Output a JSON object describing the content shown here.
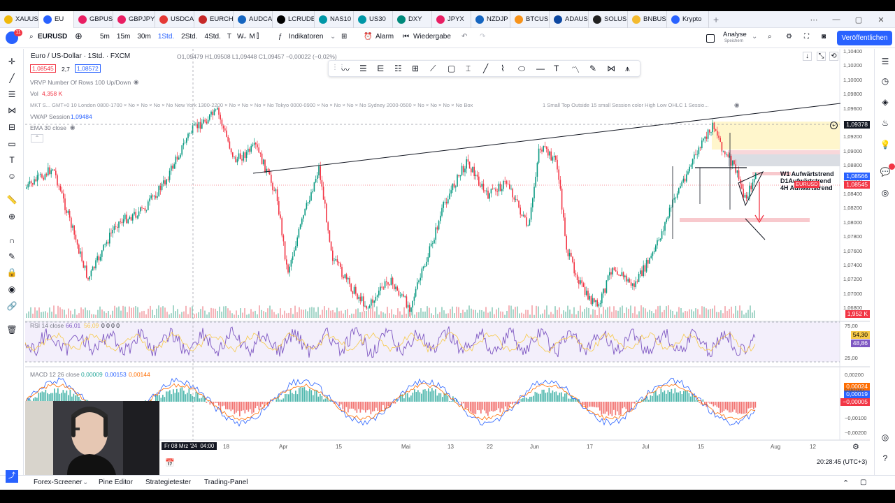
{
  "tabs": [
    {
      "label": "XAUUS",
      "color": "#f0b90b",
      "active": false
    },
    {
      "label": "EU",
      "color": "#2962ff",
      "active": true
    },
    {
      "label": "GBPUS",
      "color": "#e91e63",
      "active": false
    },
    {
      "label": "GBPJPY",
      "color": "#e91e63",
      "active": false
    },
    {
      "label": "USDCA",
      "color": "#e53935",
      "active": false
    },
    {
      "label": "EURCH",
      "color": "#c62828",
      "active": false
    },
    {
      "label": "AUDCA",
      "color": "#1565c0",
      "active": false
    },
    {
      "label": "LCRUDE",
      "color": "#000000",
      "active": false
    },
    {
      "label": "NAS10",
      "color": "#0097a7",
      "active": false
    },
    {
      "label": "US30",
      "color": "#0097a7",
      "active": false
    },
    {
      "label": "DXY",
      "color": "#00897b",
      "active": false
    },
    {
      "label": "JPYX",
      "color": "#e91e63",
      "active": false
    },
    {
      "label": "NZDJP",
      "color": "#1565c0",
      "active": false
    },
    {
      "label": "BTCUS",
      "color": "#f7931a",
      "active": false
    },
    {
      "label": "ADAUS",
      "color": "#0d47a1",
      "active": false
    },
    {
      "label": "SOLUS",
      "color": "#212121",
      "active": false
    },
    {
      "label": "BNBUS",
      "color": "#f3ba2f",
      "active": false
    },
    {
      "label": "Krypto",
      "color": "#2962ff",
      "active": false
    }
  ],
  "topbar": {
    "symbol": "EURUSD",
    "notif_count": "11",
    "timeframes": [
      "5m",
      "15m",
      "30m",
      "1Std.",
      "2Std.",
      "4Std.",
      "T",
      "W",
      "M"
    ],
    "active_timeframe": "1Std.",
    "indicators": "Indikatoren",
    "alarm": "Alarm",
    "replay": "Wiedergabe",
    "analyse": "Analyse",
    "analyse_sub": "Speichern",
    "publish": "Veröffentlichen"
  },
  "legend": {
    "title": "Euro / US-Dollar · 1Std. · FXCM",
    "ohlc": "O1,09479 H1,09508 L1,09448 C1,09457 −0,00022 (−0,02%)",
    "bid": "1,08545",
    "spread": "2,7",
    "ask": "1,08572",
    "vrvp": "VRVP Number Of Rows 100 Up/Down",
    "vol_label": "Vol",
    "vol_value": "4,358 K",
    "mkt": "MKT S... GMT+0 10 London 0800-1700 × No × No × No × No New York 1300-2200 × No × No × No × No Tokyo 0000-0900 × No × No × No × No Sydney 2000-0500 × No × No × No × No Box",
    "mkt2": "1 Small Top Outside 15 small Session color High Low OHLC 1 Sessio...",
    "vwap_label": "VWAP Session",
    "vwap_value": "1,09484",
    "ema": "EMA 30 close",
    "rsi": "RSI 14 close",
    "rsi_value": "66,01",
    "rsi_value2": "56,09",
    "rsi_zeros": "0 0 0 0",
    "macd": "MACD 12 26 close",
    "macd_v1": "0,00009",
    "macd_v2": "0,00153",
    "macd_v3": "0,00144"
  },
  "annotations": [
    "W1 Aufwärtstrend",
    "D1Aufwärtstrend",
    "4H Aufwärtstrend"
  ],
  "price_axis": [
    "1,10400",
    "1,10200",
    "1,10000",
    "1,09800",
    "1,09600",
    "1,09400",
    "1,09200",
    "1,09000",
    "1,08800",
    "1,08600",
    "1,08400",
    "1,08200",
    "1,08000",
    "1,07800",
    "1,07600",
    "1,07400",
    "1,07200",
    "1,07000",
    "1,06800"
  ],
  "price_tags": [
    {
      "text": "1,09378",
      "bg": "#131722"
    },
    {
      "text": "1,08566",
      "bg": "#2962ff"
    },
    {
      "text": "1,08545",
      "bg": "#f23645"
    },
    {
      "text": "1,952 K",
      "bg": "#f23645"
    }
  ],
  "symbol_tag": "EURUSD",
  "rsi_axis": [
    "75,00",
    "25,00"
  ],
  "rsi_tags": [
    {
      "text": "54,30",
      "bg": "#f7c948"
    },
    {
      "text": "48,86",
      "bg": "#7e57c2"
    }
  ],
  "macd_axis": [
    "0,00200",
    "0,00100",
    "−0,00100",
    "−0,00200"
  ],
  "macd_tags": [
    {
      "text": "0,00024",
      "bg": "#ff6d00"
    },
    {
      "text": "0,00019",
      "bg": "#2962ff"
    },
    {
      "text": "−0,00005",
      "bg": "#f23645"
    }
  ],
  "time_axis": [
    "18",
    "Apr",
    "15",
    "Mai",
    "13",
    "22",
    "Jun",
    "17",
    "Jul",
    "15",
    "Aug",
    "12"
  ],
  "crosshair_time": "Fr 08 Mrz '24",
  "crosshair_hour": "04:00",
  "clock": "20:28:45 (UTC+3)",
  "bottom": [
    "Forex-Screener",
    "Pine Editor",
    "Strategietester",
    "Trading-Panel"
  ],
  "colors": {
    "up": "#089981",
    "down": "#f23645",
    "accent": "#2962ff"
  }
}
